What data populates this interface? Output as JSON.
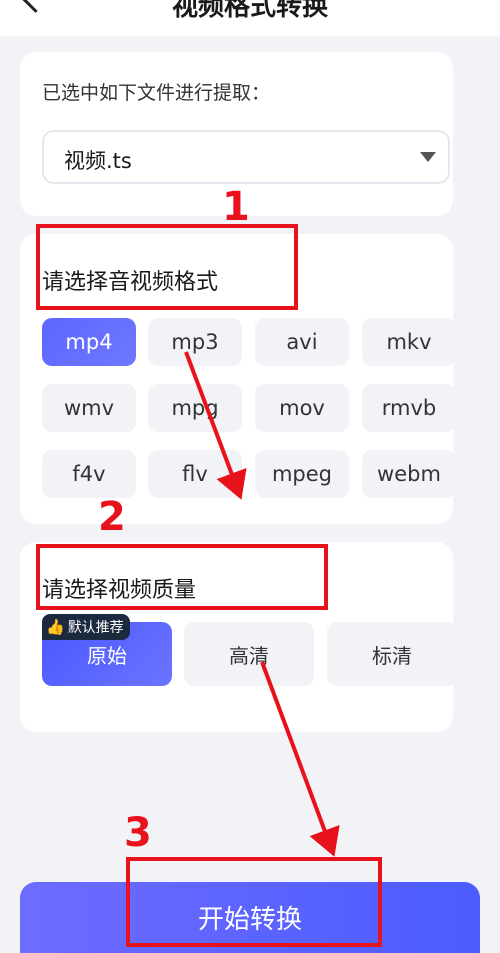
{
  "header": {
    "title": "视频格式转换"
  },
  "file_card": {
    "label": "已选中如下文件进行提取：",
    "selected_file": "视频.ts"
  },
  "format_card": {
    "title": "请选择音视频格式",
    "formats": [
      "mp4",
      "mp3",
      "avi",
      "mkv",
      "wmv",
      "mpg",
      "mov",
      "rmvb",
      "f4v",
      "flv",
      "mpeg",
      "webm"
    ],
    "selected": "mp4"
  },
  "quality_card": {
    "title": "请选择视频质量",
    "badge": "默认推荐",
    "options": [
      "原始",
      "高清",
      "标清"
    ],
    "selected": "原始"
  },
  "action": {
    "start_label": "开始转换"
  },
  "annotations": {
    "step1": "1",
    "step2": "2",
    "step3": "3"
  },
  "colors": {
    "accent": "#5e66ff",
    "annotation_red": "#e8121c",
    "background": "#f2f3f7"
  },
  "icons": {
    "back": "chevron-left-icon",
    "dropdown": "caret-down-icon",
    "thumb": "thumbs-up-icon"
  }
}
